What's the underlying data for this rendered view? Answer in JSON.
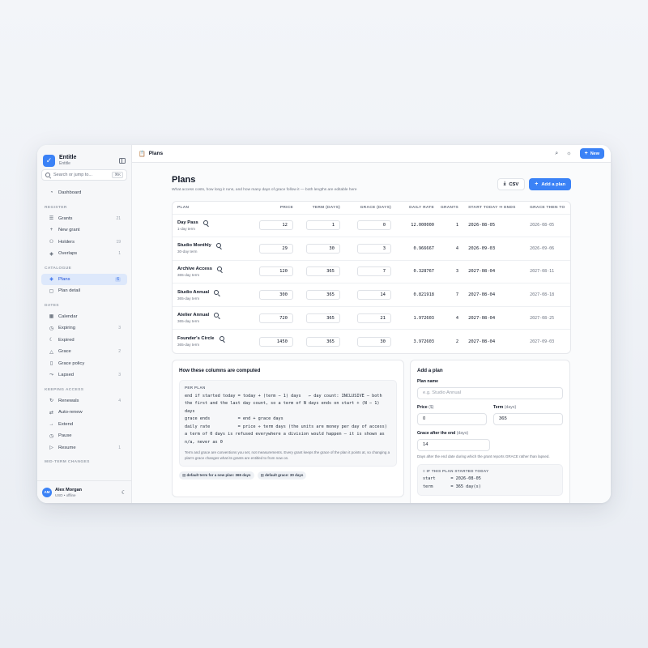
{
  "brand": {
    "name": "Entitle",
    "sub": "Entitle"
  },
  "search": {
    "placeholder": "Search or jump to...",
    "shortcut": "⌘K"
  },
  "nav": {
    "top": [
      {
        "label": "Dashboard",
        "icon": "◔"
      }
    ],
    "sections": [
      {
        "title": "REGISTER",
        "items": [
          {
            "label": "Grants",
            "icon": "☰",
            "count": "21"
          },
          {
            "label": "New grant",
            "icon": "+",
            "count": ""
          },
          {
            "label": "Holders",
            "icon": "⚇",
            "count": "19"
          },
          {
            "label": "Overlaps",
            "icon": "◈",
            "count": "1"
          }
        ]
      },
      {
        "title": "CATALOGUE",
        "items": [
          {
            "label": "Plans",
            "icon": "◈",
            "count": "6"
          },
          {
            "label": "Plan detail",
            "icon": "▢",
            "count": ""
          }
        ]
      },
      {
        "title": "DATES",
        "items": [
          {
            "label": "Calendar",
            "icon": "▦",
            "count": ""
          },
          {
            "label": "Expiring",
            "icon": "◷",
            "count": "3"
          },
          {
            "label": "Expired",
            "icon": "☾",
            "count": ""
          },
          {
            "label": "Grace",
            "icon": "△",
            "count": "2"
          },
          {
            "label": "Grace policy",
            "icon": "▯",
            "count": ""
          },
          {
            "label": "Lapsed",
            "icon": "⤳",
            "count": "3"
          }
        ]
      },
      {
        "title": "KEEPING ACCESS",
        "items": [
          {
            "label": "Renewals",
            "icon": "↻",
            "count": "4"
          },
          {
            "label": "Auto-renew",
            "icon": "⇄",
            "count": ""
          },
          {
            "label": "Extend",
            "icon": "→",
            "count": ""
          },
          {
            "label": "Pause",
            "icon": "◷",
            "count": ""
          },
          {
            "label": "Resume",
            "icon": "▷",
            "count": "1"
          }
        ]
      },
      {
        "title": "MID-TERM CHANGES",
        "items": []
      }
    ]
  },
  "user": {
    "initials": "AM",
    "name": "Alex Morgan",
    "sub": "USD • offline"
  },
  "topbar": {
    "crumb": "Plans",
    "new_label": "New"
  },
  "page": {
    "title": "Plans",
    "desc": "What access costs, how long it runs, and how many days of grace follow it — both lengths are editable here",
    "csv_label": "CSV",
    "add_label": "Add a plan"
  },
  "table": {
    "headers": {
      "plan": "PLAN",
      "price": "PRICE",
      "term": "TERM (DAYS)",
      "grace": "GRACE (DAYS)",
      "daily": "DAILY RATE",
      "grants": "GRANTS",
      "ends": "START TODAY ⇒ ENDS",
      "grace_to": "GRACE THEN TO"
    },
    "rows": [
      {
        "name": "Day Pass",
        "term_label": "1-day term",
        "price": "12",
        "term": "1",
        "grace": "0",
        "daily": "12.000000",
        "grants": "1",
        "ends": "2026-08-05",
        "grace_to": "2026-08-05"
      },
      {
        "name": "Studio Monthly",
        "term_label": "30-day term",
        "price": "29",
        "term": "30",
        "grace": "3",
        "daily": "0.966667",
        "grants": "4",
        "ends": "2026-09-03",
        "grace_to": "2026-09-06"
      },
      {
        "name": "Archive Access",
        "term_label": "365-day term",
        "price": "120",
        "term": "365",
        "grace": "7",
        "daily": "0.328767",
        "grants": "3",
        "ends": "2027-08-04",
        "grace_to": "2027-08-11"
      },
      {
        "name": "Studio Annual",
        "term_label": "365-day term",
        "price": "300",
        "term": "365",
        "grace": "14",
        "daily": "0.821918",
        "grants": "7",
        "ends": "2027-08-04",
        "grace_to": "2027-08-18"
      },
      {
        "name": "Atelier Annual",
        "term_label": "365-day term",
        "price": "720",
        "term": "365",
        "grace": "21",
        "daily": "1.972603",
        "grants": "4",
        "ends": "2027-08-04",
        "grace_to": "2027-08-25"
      },
      {
        "name": "Founder's Circle",
        "term_label": "365-day term",
        "price": "1450",
        "term": "365",
        "grace": "30",
        "daily": "3.972603",
        "grants": "2",
        "ends": "2027-08-04",
        "grace_to": "2027-09-03"
      }
    ]
  },
  "explain": {
    "title": "How these columns are computed",
    "label": "PER PLAN",
    "code": "end if started today = today + (term − 1) days   ← day count: INCLUSIVE — both the first and the last day count, so a term of N days ends on start + (N − 1) days\ngrace ends           = end + grace days\ndaily rate           = price ÷ term days (the units are money per day of access)\na term of 0 days is refused everywhere a division would happen — it is shown as n/a, never as 0",
    "note": "Term and grace are conventions you set, not measurements. Every grant keeps the grace of the plan it points at, so changing a plan's grace changes what its grants are entitled to from now on.",
    "chip1": "default term for a new plan: 365 days",
    "chip2": "default grace: 30 days"
  },
  "addplan": {
    "title": "Add a plan",
    "name_label": "Plan name",
    "name_placeholder": "e.g. Studio Annual",
    "price_label": "Price",
    "price_unit": "($)",
    "price_value": "0",
    "term_label": "Term",
    "term_unit": "(days)",
    "term_value": "365",
    "grace_label": "Grace after the end",
    "grace_unit": "(days)",
    "grace_value": "14",
    "hint": "Days after the end date during which the grant reports GRACE rather than lapsed.",
    "started_label": "IF THIS PLAN STARTED TODAY",
    "started_code": "start      = 2026-08-05\nterm       = 365 day(s)"
  }
}
